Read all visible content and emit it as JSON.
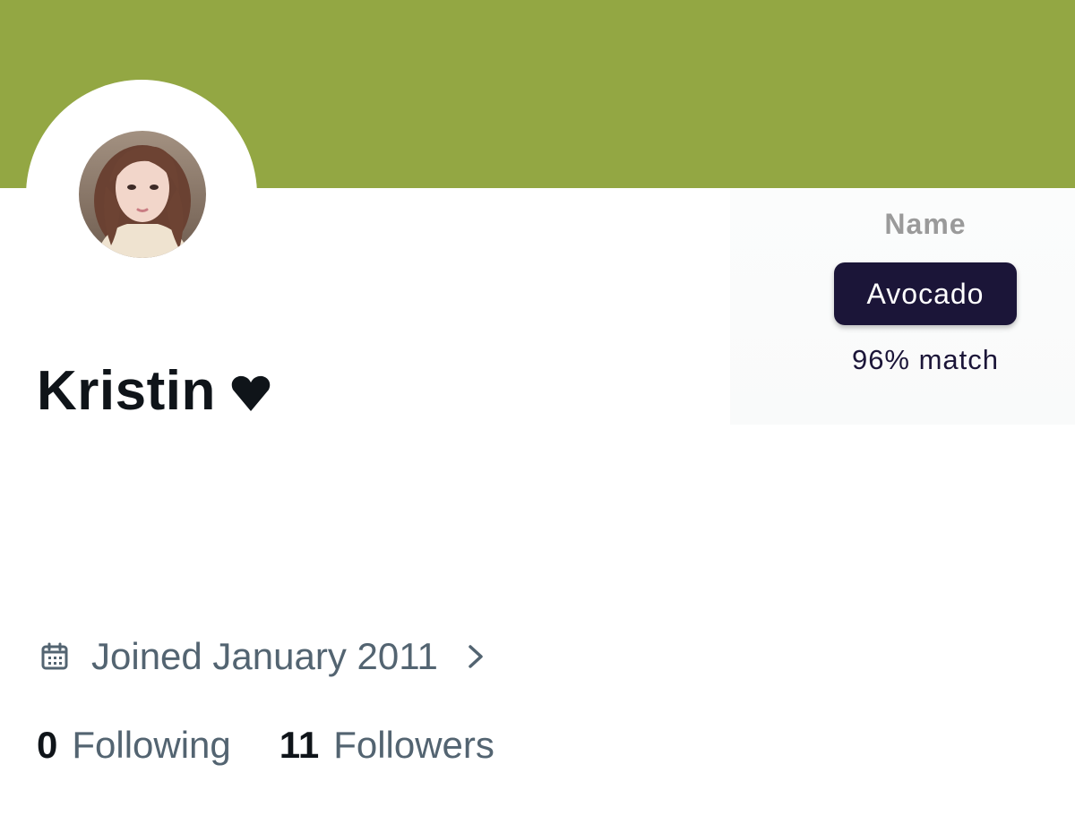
{
  "colors": {
    "banner": "#93a743",
    "pill": "#1b1538",
    "muted": "#536471",
    "heading": "#0f1419"
  },
  "profile": {
    "display_name": "Kristin",
    "heart_icon": "black-heart-icon",
    "joined_text": "Joined January 2011"
  },
  "match": {
    "title": "Name",
    "name": "Avocado",
    "score_text": "96% match"
  },
  "stats": {
    "following_count": "0",
    "following_label": "Following",
    "followers_count": "11",
    "followers_label": "Followers"
  },
  "icons": {
    "calendar": "calendar-icon",
    "chevron": "chevron-right-icon"
  }
}
